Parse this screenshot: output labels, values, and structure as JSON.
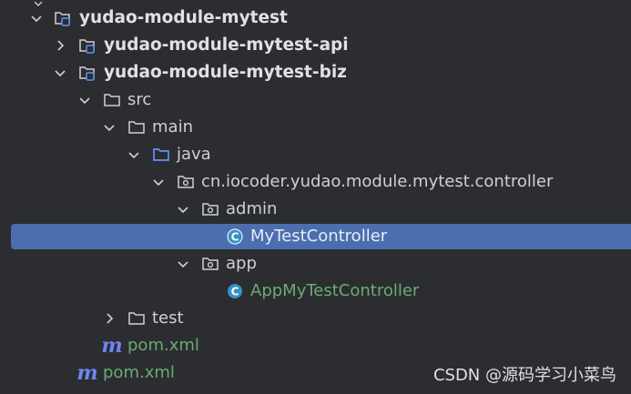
{
  "tree": [
    {
      "label": "yudao-module-mytest",
      "type": "module",
      "expanded": true,
      "bold": true
    },
    {
      "label": "yudao-module-mytest-api",
      "type": "module",
      "expanded": false,
      "bold": true
    },
    {
      "label": "yudao-module-mytest-biz",
      "type": "module",
      "expanded": true,
      "bold": true
    },
    {
      "label": "src",
      "type": "folder",
      "expanded": true
    },
    {
      "label": "main",
      "type": "folder",
      "expanded": true
    },
    {
      "label": "java",
      "type": "source-root",
      "expanded": true
    },
    {
      "label": "cn.iocoder.yudao.module.mytest.controller",
      "type": "package",
      "expanded": true
    },
    {
      "label": "admin",
      "type": "package",
      "expanded": true
    },
    {
      "label": "MyTestController",
      "type": "class",
      "selected": true
    },
    {
      "label": "app",
      "type": "package",
      "expanded": true
    },
    {
      "label": "AppMyTestController",
      "type": "class",
      "color": "green"
    },
    {
      "label": "test",
      "type": "folder",
      "expanded": false
    },
    {
      "label": "pom.xml",
      "type": "maven",
      "color": "green"
    },
    {
      "label": "pom.xml",
      "type": "maven",
      "color": "green"
    }
  ],
  "watermark": "CSDN @源码学习小菜鸟",
  "colors": {
    "background": "#2b2d30",
    "selection": "#4b6eaf",
    "text": "#dfe1e5",
    "green_text": "#6aab73",
    "class_icon": "#3592c4",
    "source_root": "#5c94f4",
    "maven": "#6f86f5"
  }
}
